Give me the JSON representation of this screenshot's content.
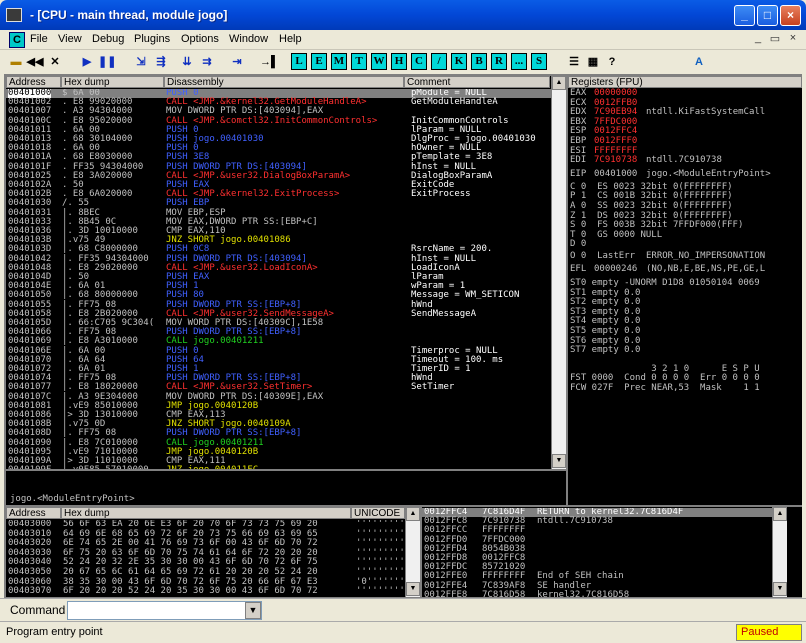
{
  "window": {
    "title": "- [CPU - main thread, module jogo]",
    "min": "_",
    "max": "□",
    "close": "×"
  },
  "menu": [
    "File",
    "View",
    "Debug",
    "Plugins",
    "Options",
    "Window",
    "Help"
  ],
  "toolbar_letters": [
    "L",
    "E",
    "M",
    "T",
    "W",
    "H",
    "C",
    "/",
    "K",
    "B",
    "R",
    "...",
    "S"
  ],
  "disasm": {
    "headers": [
      "Address",
      "Hex dump",
      "Disassembly",
      "Comment"
    ],
    "rows": [
      [
        "00401000",
        "$ 6A 00",
        "PUSH 0",
        "pModule = NULL"
      ],
      [
        "00401002",
        ". E8 99020000",
        "CALL <JMP.&kernel32.GetModuleHandleA>",
        "GetModuleHandleA"
      ],
      [
        "00401007",
        ". A3 94304000",
        "MOV DWORD PTR DS:[403094],EAX",
        ""
      ],
      [
        "0040100C",
        ". E8 95020000",
        "CALL <JMP.&comctl32.InitCommonControls>",
        "InitCommonControls"
      ],
      [
        "00401011",
        ". 6A 00",
        "PUSH 0",
        "lParam = NULL"
      ],
      [
        "00401013",
        ". 68 30104000",
        "PUSH jogo.00401030",
        "DlgProc = jogo.00401030"
      ],
      [
        "00401018",
        ". 6A 00",
        "PUSH 0",
        "hOwner = NULL"
      ],
      [
        "0040101A",
        ". 68 E8030000",
        "PUSH 3E8",
        "pTemplate = 3E8"
      ],
      [
        "0040101F",
        ". FF35 94304000",
        "PUSH DWORD PTR DS:[403094]",
        "hInst = NULL"
      ],
      [
        "00401025",
        ". E8 3A020000",
        "CALL <JMP.&user32.DialogBoxParamA>",
        "DialogBoxParamA"
      ],
      [
        "0040102A",
        ". 50",
        "PUSH EAX",
        "ExitCode"
      ],
      [
        "0040102B",
        ". E8 6A020000",
        "CALL <JMP.&kernel32.ExitProcess>",
        "ExitProcess"
      ],
      [
        "00401030",
        "/. 55",
        "PUSH EBP",
        ""
      ],
      [
        "00401031",
        "|. 8BEC",
        "MOV EBP,ESP",
        ""
      ],
      [
        "00401033",
        "|. 8B45 0C",
        "MOV EAX,DWORD PTR SS:[EBP+C]",
        ""
      ],
      [
        "00401036",
        "|. 3D 10010000",
        "CMP EAX,110",
        ""
      ],
      [
        "0040103B",
        "|.v75 49",
        "JNZ SHORT jogo.00401086",
        ""
      ],
      [
        "0040103D",
        "|. 68 C8000000",
        "PUSH 0C8",
        "RsrcName = 200."
      ],
      [
        "00401042",
        "|. FF35 94304000",
        "PUSH DWORD PTR DS:[403094]",
        "hInst = NULL"
      ],
      [
        "00401048",
        "|. E8 29020000",
        "CALL <JMP.&user32.LoadIconA>",
        "LoadIconA"
      ],
      [
        "0040104D",
        "|. 50",
        "PUSH EAX",
        "lParam"
      ],
      [
        "0040104E",
        "|. 6A 01",
        "PUSH 1",
        "wParam = 1"
      ],
      [
        "00401050",
        "|. 68 80000000",
        "PUSH 80",
        "Message = WM_SETICON"
      ],
      [
        "00401055",
        "|. FF75 08",
        "PUSH DWORD PTR SS:[EBP+8]",
        "hWnd"
      ],
      [
        "00401058",
        "|. E8 2B020000",
        "CALL <JMP.&user32.SendMessageA>",
        "SendMessageA"
      ],
      [
        "0040105D",
        "|. 66:C705 9C304(",
        "MOV WORD PTR DS:[40309C],1E58",
        ""
      ],
      [
        "00401066",
        "|. FF75 08",
        "PUSH DWORD PTR SS:[EBP+8]",
        ""
      ],
      [
        "00401069",
        "|. E8 A3010000",
        "CALL jogo.00401211",
        ""
      ],
      [
        "0040106E",
        "|. 6A 00",
        "PUSH 0",
        "Timerproc = NULL"
      ],
      [
        "00401070",
        "|. 6A 64",
        "PUSH 64",
        "Timeout = 100. ms"
      ],
      [
        "00401072",
        "|. 6A 01",
        "PUSH 1",
        "TimerID = 1"
      ],
      [
        "00401074",
        "|. FF75 08",
        "PUSH DWORD PTR SS:[EBP+8]",
        "hWnd"
      ],
      [
        "00401077",
        "|. E8 18020000",
        "CALL <JMP.&user32.SetTimer>",
        "SetTimer"
      ],
      [
        "0040107C",
        "|. A3 9E304000",
        "MOV DWORD PTR DS:[40309E],EAX",
        ""
      ],
      [
        "00401081",
        "|.vE9 85010000",
        "JMP jogo.0040120B",
        ""
      ],
      [
        "00401086",
        "|> 3D 13010000",
        "CMP EAX,113",
        ""
      ],
      [
        "0040108B",
        "|.v75 0D",
        "JNZ SHORT jogo.0040109A",
        ""
      ],
      [
        "0040108D",
        "|. FF75 08",
        "PUSH DWORD PTR SS:[EBP+8]",
        ""
      ],
      [
        "00401090",
        "|. E8 7C010000",
        "CALL jogo.00401211",
        ""
      ],
      [
        "00401095",
        "|.vE9 71010000",
        "JMP jogo.0040120B",
        ""
      ],
      [
        "0040109A",
        "|> 3D 11010000",
        "CMP EAX,111",
        ""
      ],
      [
        "0040109F",
        "|.v0F85 57010000",
        "JNZ jogo.004011FC",
        ""
      ]
    ],
    "info": "jogo.<ModuleEntryPoint>"
  },
  "registers": {
    "header": "Registers (FPU)",
    "gp": [
      [
        "EAX",
        "00000000",
        ""
      ],
      [
        "ECX",
        "0012FFB0",
        ""
      ],
      [
        "EDX",
        "7C90EB94",
        "ntdll.KiFastSystemCall"
      ],
      [
        "EBX",
        "7FFDC000",
        ""
      ],
      [
        "ESP",
        "0012FFC4",
        ""
      ],
      [
        "EBP",
        "0012FFF0",
        ""
      ],
      [
        "ESI",
        "FFFFFFFF",
        ""
      ],
      [
        "EDI",
        "7C910738",
        "ntdll.7C910738"
      ]
    ],
    "eip": [
      "EIP",
      "00401000",
      "jogo.<ModuleEntryPoint>"
    ],
    "flags": [
      "C 0  ES 0023 32bit 0(FFFFFFFF)",
      "P 1  CS 001B 32bit 0(FFFFFFFF)",
      "A 0  SS 0023 32bit 0(FFFFFFFF)",
      "Z 1  DS 0023 32bit 0(FFFFFFFF)",
      "S 0  FS 003B 32bit 7FFDF000(FFF)",
      "T 0  GS 0000 NULL",
      "D 0"
    ],
    "lasterr": [
      "O 0  LastErr",
      "ERROR_NO_IMPERSONATION"
    ],
    "efl": [
      "EFL",
      "00000246",
      "(NO,NB,E,BE,NS,PE,GE,L"
    ],
    "fpu": [
      "ST0 empty -UNORM D1D8 01050104 0069",
      "ST1 empty 0.0",
      "ST2 empty 0.0",
      "ST3 empty 0.0",
      "ST4 empty 0.0",
      "ST5 empty 0.0",
      "ST6 empty 0.0",
      "ST7 empty 0.0"
    ],
    "fpubits": "               3 2 1 0      E S P U",
    "fst": "FST 0000  Cond 0 0 0 0  Err 0 0 0 0",
    "fcw": "FCW 027F  Prec NEAR,53  Mask    1 1"
  },
  "dump": {
    "headers": [
      "Address",
      "Hex dump",
      "UNICODE"
    ],
    "rows": [
      [
        "00403000",
        "56 6F 63 EA 20 6E E3 6F 20 70 6F 73 73 75 69 20",
        "''''''''''"
      ],
      [
        "00403010",
        "64 69 6E 68 65 69 72 6F 20 73 75 66 69 63 69 65",
        "''''''''''"
      ],
      [
        "00403020",
        "6E 74 65 2E 00 41 76 69 73 6F 00 43 6F 6D 70 72",
        "''''''''''"
      ],
      [
        "00403030",
        "6F 75 20 63 6F 6D 70 75 74 61 64 6F 72 20 20 20",
        "''''''''''"
      ],
      [
        "00403040",
        "52 24 20 32 2E 35 30 30 00 43 6F 6D 70 72 6F 75",
        "''''''''''"
      ],
      [
        "00403050",
        "20 67 65 6C 61 64 65 69 72 61 20 20 20 52 24 20",
        "''''''''''"
      ],
      [
        "00403060",
        "38 35 30 00 43 6F 6D 70 72 6F 75 20 66 6F 67 E3",
        "'0'''''''"
      ],
      [
        "00403070",
        "6F 20 20 20 52 24 20 35 30 30 00 43 6F 6D 70 72",
        "''''''''''"
      ]
    ]
  },
  "stack": {
    "rows": [
      [
        "0012FFC4",
        "7C816D4F",
        "RETURN to kernel32.7C816D4F"
      ],
      [
        "0012FFC8",
        "7C910738",
        "ntdll.7C910738"
      ],
      [
        "0012FFCC",
        "FFFFFFFF",
        ""
      ],
      [
        "0012FFD0",
        "7FFDC000",
        ""
      ],
      [
        "0012FFD4",
        "8054B038",
        ""
      ],
      [
        "0012FFD8",
        "0012FFC8",
        ""
      ],
      [
        "0012FFDC",
        "85721020",
        ""
      ],
      [
        "0012FFE0",
        "FFFFFFFF",
        "End of SEH chain"
      ],
      [
        "0012FFE4",
        "7C839AF8",
        "SE handler"
      ],
      [
        "0012FFE8",
        "7C816D58",
        "kernel32.7C816D58"
      ]
    ]
  },
  "command": {
    "label": "Command",
    "value": ""
  },
  "status": {
    "text": "Program entry point",
    "state": "Paused"
  }
}
